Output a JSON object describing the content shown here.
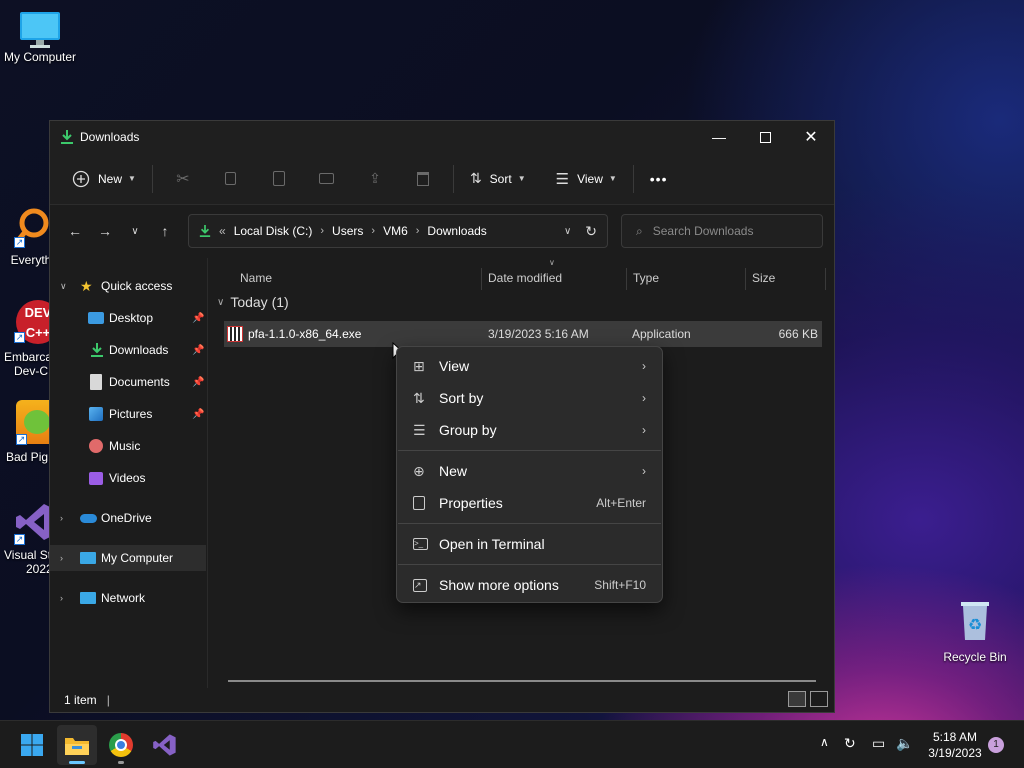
{
  "desktop": {
    "icons": [
      {
        "label": "My Computer"
      },
      {
        "label": "Everyth"
      },
      {
        "label": "Embarca",
        "label2": "Dev-C"
      },
      {
        "label": "Bad Pig"
      },
      {
        "label": "Visual St",
        "label2": "2022"
      },
      {
        "label": "Recycle Bin"
      }
    ]
  },
  "window": {
    "title": "Downloads",
    "toolbar": {
      "new_label": "New",
      "sort_label": "Sort",
      "view_label": "View",
      "more_label": "•••"
    },
    "address": {
      "prefix": "«",
      "crumbs": [
        "Local Disk (C:)",
        "Users",
        "VM6",
        "Downloads"
      ]
    },
    "search": {
      "placeholder": "Search Downloads"
    },
    "nav": {
      "quick_access": "Quick access",
      "items": [
        "Desktop",
        "Downloads",
        "Documents",
        "Pictures",
        "Music",
        "Videos"
      ],
      "onedrive": "OneDrive",
      "my_computer": "My Computer",
      "network": "Network"
    },
    "columns": [
      "Name",
      "Date modified",
      "Type",
      "Size"
    ],
    "group": {
      "label": "Today (1)"
    },
    "files": [
      {
        "name": "pfa-1.1.0-x86_64.exe",
        "date": "3/19/2023 5:16 AM",
        "type": "Application",
        "size": "666 KB"
      }
    ],
    "status": {
      "count": "1 item",
      "cursor": "|"
    }
  },
  "context_menu": {
    "items": [
      {
        "label": "View",
        "icon": "grid-icon",
        "submenu": true
      },
      {
        "label": "Sort by",
        "icon": "sort-icon",
        "submenu": true
      },
      {
        "label": "Group by",
        "icon": "list-icon",
        "submenu": true
      },
      {
        "label": "New",
        "icon": "plus-circle-icon",
        "submenu": true
      },
      {
        "label": "Properties",
        "icon": "properties-icon",
        "shortcut": "Alt+Enter"
      },
      {
        "label": "Open in Terminal",
        "icon": "terminal-icon"
      },
      {
        "label": "Show more options",
        "icon": "share-icon",
        "shortcut": "Shift+F10"
      }
    ]
  },
  "taskbar": {
    "time": "5:18 AM",
    "date": "3/19/2023",
    "notification_count": "1"
  },
  "colors": {
    "accent": "#0078d4",
    "selected_row": "#3b3b3b",
    "menu_bg": "#2b2b2b"
  }
}
